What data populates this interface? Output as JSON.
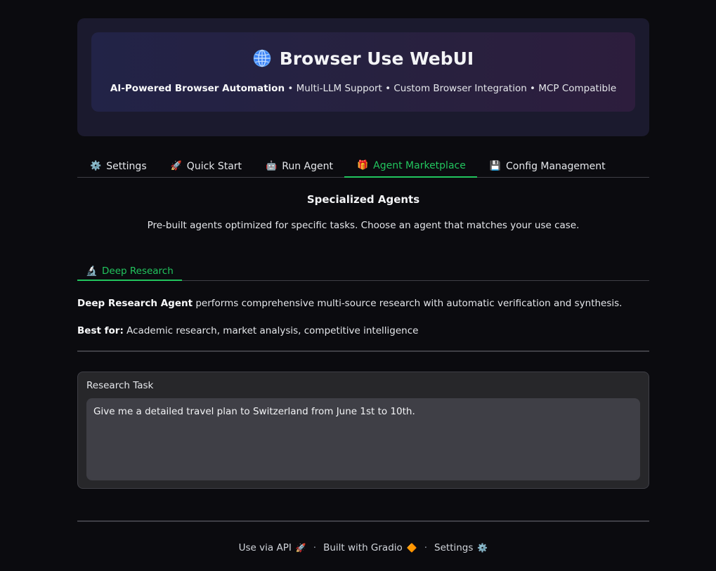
{
  "header": {
    "title": "Browser Use WebUI",
    "subtitle_bold": "AI-Powered Browser Automation",
    "subtitle_rest": " • Multi-LLM Support • Custom Browser Integration • MCP Compatible"
  },
  "tabs": [
    {
      "icon": "⚙️",
      "label": "Settings"
    },
    {
      "icon": "🚀",
      "label": "Quick Start"
    },
    {
      "icon": "🤖",
      "label": "Run Agent"
    },
    {
      "icon": "🎁",
      "label": "Agent Marketplace"
    },
    {
      "icon": "💾",
      "label": "Config Management"
    }
  ],
  "active_tab": "Agent Marketplace",
  "marketplace": {
    "title": "Specialized Agents",
    "description": "Pre-built agents optimized for specific tasks. Choose an agent that matches your use case."
  },
  "subtab": {
    "icon": "🔬",
    "label": "Deep Research"
  },
  "agent": {
    "name": "Deep Research Agent",
    "description": " performs comprehensive multi-source research with automatic verification and synthesis.",
    "best_for_label": "Best for:",
    "best_for": " Academic research, market analysis, competitive intelligence"
  },
  "task": {
    "label": "Research Task",
    "value": "Give me a detailed travel plan to Switzerland from June 1st to 10th."
  },
  "footer": {
    "api": "Use via API",
    "api_icon": "🚀",
    "built": "Built with Gradio",
    "built_icon": "🔶",
    "settings": "Settings",
    "settings_icon": "⚙️",
    "separator": "·"
  },
  "colors": {
    "accent": "#22c55e",
    "background": "#0b0b0f",
    "header_bg": "#1b1a2e"
  }
}
